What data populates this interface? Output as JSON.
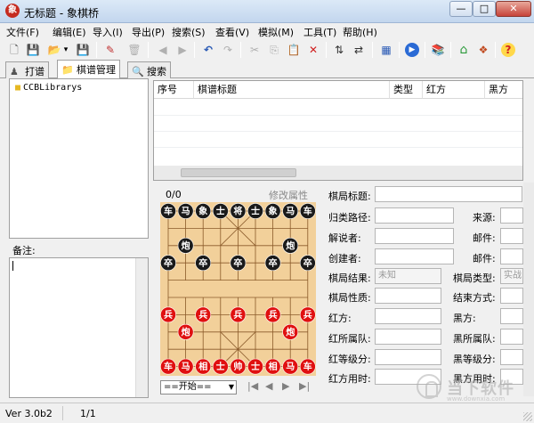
{
  "window": {
    "title": "无标题 - 象棋桥",
    "app_icon": "象",
    "min_glyph": "—",
    "max_glyph": "□",
    "close_glyph": "✕"
  },
  "menu": [
    "文件(F)",
    "编辑(E)",
    "导入(I)",
    "导出(P)",
    "搜索(S)",
    "查看(V)",
    "模拟(M)",
    "工具(T)",
    "帮助(H)"
  ],
  "toolbar": {
    "new_glyph": "🗋",
    "save_glyph": "💾",
    "open_glyph": "📂",
    "dropdown_glyph": "▾",
    "edit_glyph": "✎",
    "delete_glyph": "🗑",
    "back_glyph": "◀",
    "forward_glyph": "▶",
    "undo_glyph": "↶",
    "redo_glyph": "↷",
    "cut_glyph": "✂",
    "copy_glyph": "⎘",
    "paste_glyph": "📋",
    "remove_glyph": "✕",
    "flip_v_glyph": "⇅",
    "flip_h_glyph": "⇄",
    "board_glyph": "▦",
    "play_glyph": "▶",
    "book_glyph": "📚",
    "home_glyph": "⌂",
    "fish_glyph": "❖",
    "help_glyph": "?"
  },
  "tabs": [
    {
      "label": "打谱",
      "icon": "♟"
    },
    {
      "label": "棋谱管理",
      "icon": "📁"
    },
    {
      "label": "搜索",
      "icon": "🔍"
    }
  ],
  "library": {
    "root": "CCBLibrarys"
  },
  "notes": {
    "label": "备注:"
  },
  "grid": {
    "columns": [
      "序号",
      "棋谱标题",
      "类型",
      "红方",
      "黑方"
    ]
  },
  "board_info": {
    "move_counter": "0/0",
    "edit_attr": "修改属性",
    "start_option": "==开始==",
    "dropdown_glyph": "▼"
  },
  "nav": {
    "first": "|◀",
    "prev": "◀",
    "next": "▶",
    "last": "▶|"
  },
  "pieces": [
    {
      "side": "black",
      "text": "车",
      "col": 0,
      "row": 0
    },
    {
      "side": "black",
      "text": "马",
      "col": 1,
      "row": 0
    },
    {
      "side": "black",
      "text": "象",
      "col": 2,
      "row": 0
    },
    {
      "side": "black",
      "text": "士",
      "col": 3,
      "row": 0
    },
    {
      "side": "black",
      "text": "将",
      "col": 4,
      "row": 0
    },
    {
      "side": "black",
      "text": "士",
      "col": 5,
      "row": 0
    },
    {
      "side": "black",
      "text": "象",
      "col": 6,
      "row": 0
    },
    {
      "side": "black",
      "text": "马",
      "col": 7,
      "row": 0
    },
    {
      "side": "black",
      "text": "车",
      "col": 8,
      "row": 0
    },
    {
      "side": "black",
      "text": "炮",
      "col": 1,
      "row": 2
    },
    {
      "side": "black",
      "text": "炮",
      "col": 7,
      "row": 2
    },
    {
      "side": "black",
      "text": "卒",
      "col": 0,
      "row": 3
    },
    {
      "side": "black",
      "text": "卒",
      "col": 2,
      "row": 3
    },
    {
      "side": "black",
      "text": "卒",
      "col": 4,
      "row": 3
    },
    {
      "side": "black",
      "text": "卒",
      "col": 6,
      "row": 3
    },
    {
      "side": "black",
      "text": "卒",
      "col": 8,
      "row": 3
    },
    {
      "side": "red",
      "text": "兵",
      "col": 0,
      "row": 6
    },
    {
      "side": "red",
      "text": "兵",
      "col": 2,
      "row": 6
    },
    {
      "side": "red",
      "text": "兵",
      "col": 4,
      "row": 6
    },
    {
      "side": "red",
      "text": "兵",
      "col": 6,
      "row": 6
    },
    {
      "side": "red",
      "text": "兵",
      "col": 8,
      "row": 6
    },
    {
      "side": "red",
      "text": "炮",
      "col": 1,
      "row": 7
    },
    {
      "side": "red",
      "text": "炮",
      "col": 7,
      "row": 7
    },
    {
      "side": "red",
      "text": "车",
      "col": 0,
      "row": 9
    },
    {
      "side": "red",
      "text": "马",
      "col": 1,
      "row": 9
    },
    {
      "side": "red",
      "text": "相",
      "col": 2,
      "row": 9
    },
    {
      "side": "red",
      "text": "士",
      "col": 3,
      "row": 9
    },
    {
      "side": "red",
      "text": "帅",
      "col": 4,
      "row": 9
    },
    {
      "side": "red",
      "text": "士",
      "col": 5,
      "row": 9
    },
    {
      "side": "red",
      "text": "相",
      "col": 6,
      "row": 9
    },
    {
      "side": "red",
      "text": "马",
      "col": 7,
      "row": 9
    },
    {
      "side": "red",
      "text": "车",
      "col": 8,
      "row": 9
    }
  ],
  "form": {
    "title": "棋局标题:",
    "path": "归类路径:",
    "source": "来源:",
    "commentator": "解说者:",
    "email1": "邮件:",
    "creator": "创建者:",
    "email2": "邮件:",
    "result": "棋局结果:",
    "result_value": "未知",
    "game_type": "棋局类型:",
    "game_type_value": "实战",
    "nature": "棋局性质:",
    "end_mode": "结束方式:",
    "red": "红方:",
    "black": "黑方:",
    "red_team": "红所属队:",
    "black_team": "黑所属队:",
    "red_level": "红等级分:",
    "black_level": "黑等级分:",
    "red_time": "红方用时:",
    "black_time": "黑方用时:"
  },
  "status": {
    "version": "Ver 3.0b2",
    "page": "1/1"
  },
  "watermark": {
    "text": "当下软件园",
    "url": "www.downxia.com"
  },
  "colors": {
    "board": "#f2d09a",
    "board_line": "#8a5a2a",
    "red_piece": "#e01010",
    "black_piece": "#1a1a1a",
    "accent": "#3a7bd5"
  }
}
